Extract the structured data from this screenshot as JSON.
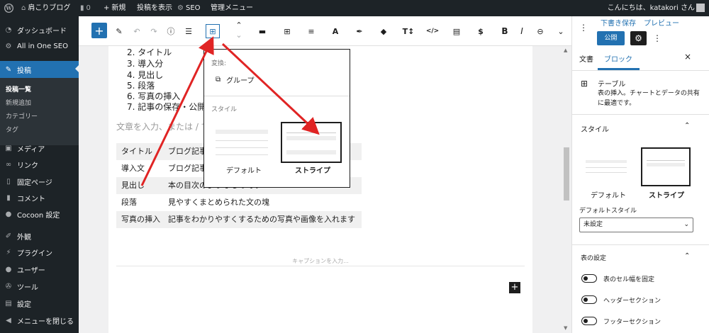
{
  "admin_bar": {
    "site_name": "肩こりブログ",
    "comments": "0",
    "new": "新規",
    "view_post": "投稿を表示",
    "seo": "SEO",
    "manage_menu": "管理メニュー",
    "greeting": "こんにちは、katakori さん"
  },
  "sidebar": {
    "items": [
      {
        "label": "ダッシュボード",
        "icon": "dashboard-icon"
      },
      {
        "label": "All in One SEO",
        "icon": "gear-icon"
      },
      {
        "label": "投稿",
        "icon": "pin-icon"
      },
      {
        "label": "メディア",
        "icon": "media-icon"
      },
      {
        "label": "リンク",
        "icon": "link-icon"
      },
      {
        "label": "固定ページ",
        "icon": "page-icon"
      },
      {
        "label": "コメント",
        "icon": "comment-icon"
      },
      {
        "label": "Cocoon 設定",
        "icon": "cocoon-icon"
      },
      {
        "label": "外観",
        "icon": "brush-icon"
      },
      {
        "label": "プラグイン",
        "icon": "plugin-icon"
      },
      {
        "label": "ユーザー",
        "icon": "user-icon"
      },
      {
        "label": "ツール",
        "icon": "wrench-icon"
      },
      {
        "label": "設定",
        "icon": "settings-icon"
      },
      {
        "label": "メニューを閉じる",
        "icon": "collapse-icon"
      }
    ],
    "submenu": [
      "投稿一覧",
      "新規追加",
      "カテゴリー",
      "タグ"
    ]
  },
  "editor": {
    "list_items": [
      "2. タイトル",
      "3. 導入分",
      "4. 見出し",
      "5. 段落",
      "6. 写真の挿入",
      "7. 記事の保存・公開"
    ],
    "placeholder": "文章を入力、または / でブロックを選択",
    "table_rows": [
      [
        "タイトル",
        "ブログ記事のタイトル"
      ],
      [
        "導入文",
        "ブログ記事の導入部分"
      ],
      [
        "見出し",
        "本の目次のようなものです"
      ],
      [
        "段落",
        "見やすくまとめられた文の塊"
      ],
      [
        "写真の挿入",
        "記事をわかりやすくするための写真や画像を入れます"
      ]
    ],
    "caption_placeholder": "キャプションを入力..."
  },
  "popover": {
    "transform_label": "変換:",
    "group": "グループ",
    "style_label": "スタイル",
    "default": "デフォルト",
    "stripe": "ストライプ"
  },
  "settings": {
    "save_draft": "下書き保存",
    "preview": "プレビュー",
    "publish": "公開",
    "tab_document": "文書",
    "tab_block": "ブロック",
    "block_name": "テーブル",
    "block_desc": "表の挿入。チャートとデータの共有に最適です。",
    "styles_title": "スタイル",
    "style_default": "デフォルト",
    "style_stripe": "ストライプ",
    "default_style_label": "デフォルトスタイル",
    "default_style_value": "未設定",
    "table_settings": "表の設定",
    "toggle_fixed": "表のセル幅を固定",
    "toggle_header": "ヘッダーセクション",
    "toggle_footer": "フッターセクション"
  },
  "colors": {
    "admin_dark": "#1d2327",
    "accent_blue": "#2271b1",
    "annotation_red": "#e02424"
  }
}
